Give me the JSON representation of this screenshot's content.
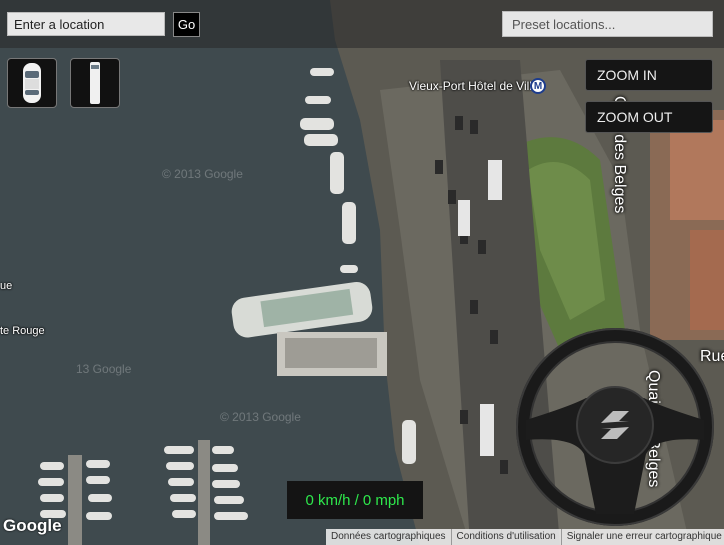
{
  "search": {
    "placeholder": "Enter a location",
    "go_label": "Go"
  },
  "preset": {
    "placeholder": "Preset locations..."
  },
  "tools": [
    {
      "name": "car-view-icon"
    },
    {
      "name": "bus-view-icon"
    }
  ],
  "zoom": {
    "in_label": "ZOOM IN",
    "out_label": "ZOOM OUT"
  },
  "speed": {
    "kmh": "0 km/h /",
    "mph": "0 mph"
  },
  "map": {
    "metro_label": "Vieux-Port Hôtel de Ville",
    "metro_symbol": "M",
    "street_quai": "Quai des Belges",
    "street_quai_lower": "Quai des Belges",
    "street_rue": "Rue",
    "left_label_1": "ue",
    "left_label_2": "te Rouge",
    "watermark": "© 2013 Google",
    "watermark_partial": "13 Google",
    "logo": "Google"
  },
  "footer": {
    "items": [
      "Données cartographiques",
      "Conditions d'utilisation",
      "Signaler une erreur cartographique"
    ]
  },
  "colors": {
    "speed_text": "#2ee84c",
    "water": "#3f4a4e",
    "metro_blue": "#1d3c8d"
  }
}
